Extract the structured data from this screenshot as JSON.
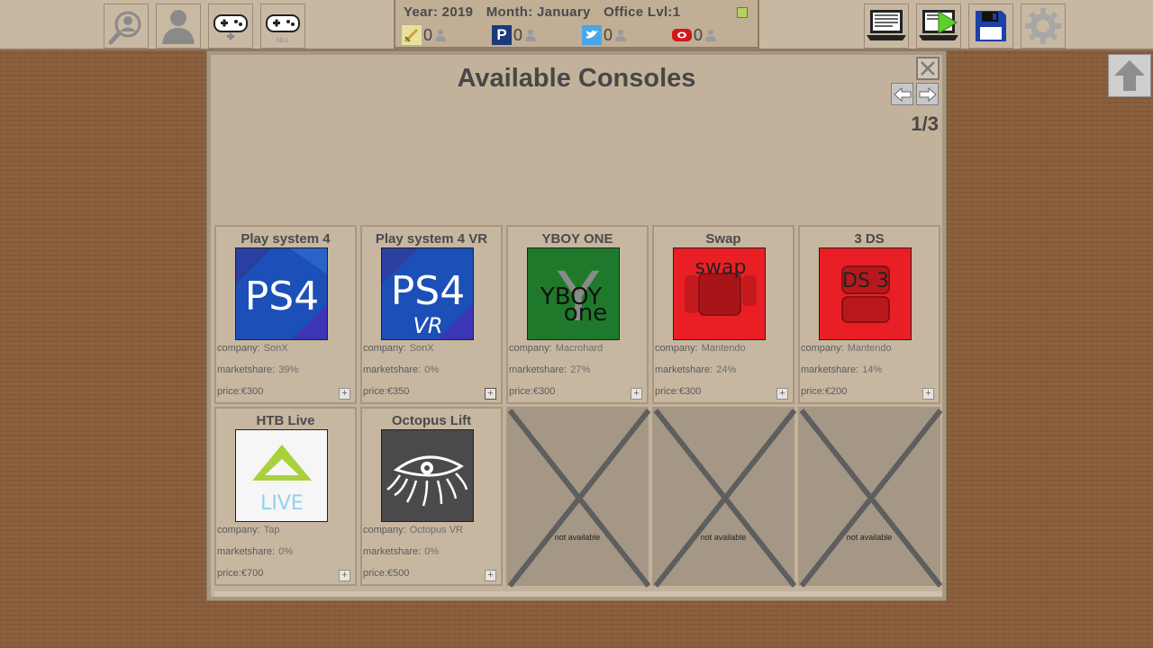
{
  "topbar": {
    "info": {
      "year_label": "Year:",
      "year": "2019",
      "month_label": "Month:",
      "month": "January",
      "office_label": "Office Lvl:",
      "office_level": "1"
    },
    "socials": [
      {
        "icon": "sword-icon",
        "count": "0"
      },
      {
        "icon": "p-icon",
        "count": "0"
      },
      {
        "icon": "bird-icon",
        "count": "0"
      },
      {
        "icon": "video-icon",
        "count": "0"
      }
    ],
    "buttons_left": [
      "search-person-icon",
      "person-icon",
      "add-console-icon",
      "sell-console-icon"
    ],
    "sell_label": "SELL",
    "buttons_right": [
      "laptop-text-icon",
      "laptop-play-icon",
      "save-icon",
      "gear-icon"
    ]
  },
  "window": {
    "title": "Available Consoles",
    "page": "1/3"
  },
  "labels": {
    "company": "company:",
    "marketshare": "marketshare:",
    "price": "price:"
  },
  "consoles": [
    {
      "name": "Play system 4",
      "company": "SonX",
      "marketshare": "39%",
      "price": "€300",
      "logo_text": "PS4"
    },
    {
      "name": "Play system 4 VR",
      "company": "SonX",
      "marketshare": "0%",
      "price": "€350",
      "logo_text": "PS4",
      "logo_sub": "VR"
    },
    {
      "name": "YBOY ONE",
      "company": "Macrohard",
      "marketshare": "27%",
      "price": "€300",
      "logo_text": "YBOY",
      "logo_sub": "one",
      "logo_bg": "Y"
    },
    {
      "name": "Swap",
      "company": "Mantendo",
      "marketshare": "24%",
      "price": "€300",
      "logo_text": "swap"
    },
    {
      "name": "3 DS",
      "company": "Mantendo",
      "marketshare": "14%",
      "price": "€200",
      "logo_text": "DS 3"
    },
    {
      "name": "HTB Live",
      "company": "Tap",
      "marketshare": "0%",
      "price": "€700",
      "logo_text": "LIVE"
    },
    {
      "name": "Octopus Lift",
      "company": "Octopus VR",
      "marketshare": "0%",
      "price": "€500"
    }
  ],
  "unavailable_text": "not available",
  "colors": {
    "topbar": "#c8b8a2",
    "window": "#c3b29b",
    "card": "#c7b7a0",
    "desk": "#8a5e3b",
    "ps_blue": "#1c4fb8",
    "yboy_green": "#1e7a2a",
    "mantendo_red": "#ea1f26"
  }
}
